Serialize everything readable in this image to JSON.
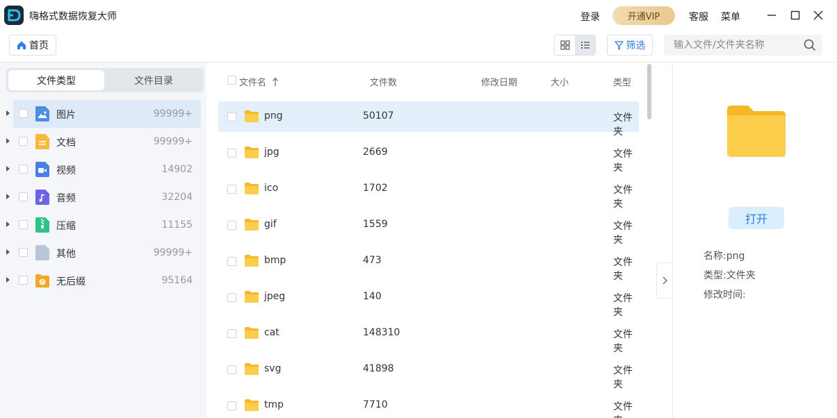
{
  "app": {
    "title": "嗨格式数据恢复大师"
  },
  "header": {
    "login": "登录",
    "vip": "开通VIP",
    "service": "客服",
    "menu": "菜单"
  },
  "toolbar": {
    "home": "首页",
    "filter": "筛选",
    "search_placeholder": "输入文件/文件夹名称"
  },
  "sidebar": {
    "tabs": [
      "文件类型",
      "文件目录"
    ],
    "categories": [
      {
        "label": "图片",
        "count": "99999+",
        "icon": "image-icon",
        "color": "#4a90e2"
      },
      {
        "label": "文档",
        "count": "99999+",
        "icon": "document-icon",
        "color": "#f5b93c"
      },
      {
        "label": "视频",
        "count": "14902",
        "icon": "video-icon",
        "color": "#4a7fe8"
      },
      {
        "label": "音频",
        "count": "32204",
        "icon": "audio-icon",
        "color": "#6c63e6"
      },
      {
        "label": "压缩",
        "count": "11155",
        "icon": "archive-icon",
        "color": "#2cc38a"
      },
      {
        "label": "其他",
        "count": "99999+",
        "icon": "other-file-icon",
        "color": "#b7c6d8"
      },
      {
        "label": "无后缀",
        "count": "95164",
        "icon": "no-suffix-icon",
        "color": "#f5a623"
      }
    ]
  },
  "list": {
    "headers": {
      "name": "文件名",
      "count": "文件数",
      "modified": "修改日期",
      "size": "大小",
      "type": "类型"
    },
    "rows": [
      {
        "name": "png",
        "count": "50107",
        "type": "文件夹"
      },
      {
        "name": "jpg",
        "count": "2669",
        "type": "文件夹"
      },
      {
        "name": "ico",
        "count": "1702",
        "type": "文件夹"
      },
      {
        "name": "gif",
        "count": "1559",
        "type": "文件夹"
      },
      {
        "name": "bmp",
        "count": "473",
        "type": "文件夹"
      },
      {
        "name": "jpeg",
        "count": "140",
        "type": "文件夹"
      },
      {
        "name": "cat",
        "count": "148310",
        "type": "文件夹"
      },
      {
        "name": "svg",
        "count": "41898",
        "type": "文件夹"
      },
      {
        "name": "tmp",
        "count": "7710",
        "type": "文件夹"
      }
    ]
  },
  "detail": {
    "open": "打开",
    "name": "名称:png",
    "type": "类型:文件夹",
    "modified": "修改时间:"
  },
  "colors": {
    "accent": "#2b7de9",
    "vip": "#e9c98e",
    "selected_row": "#e3f0fb"
  }
}
